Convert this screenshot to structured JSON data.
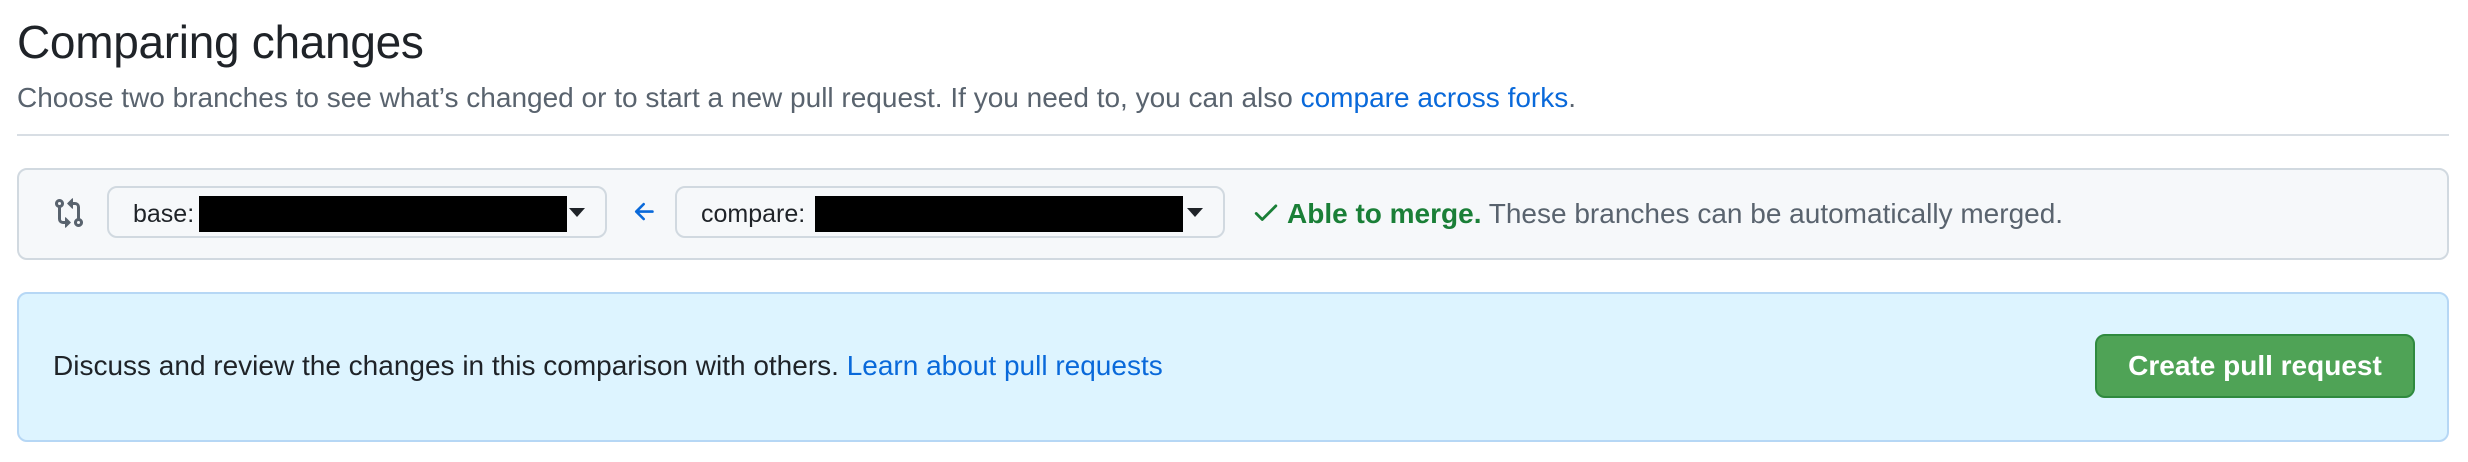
{
  "header": {
    "title": "Comparing changes",
    "subtitle_prefix": "Choose two branches to see what’s changed or to start a new pull request. If you need to, you can also ",
    "subtitle_link": "compare across forks",
    "subtitle_suffix": "."
  },
  "range": {
    "icon": "git-compare-icon",
    "base_label": "base:",
    "compare_label": "compare:",
    "arrow_icon": "arrow-left-icon",
    "merge_icon": "check-icon",
    "merge_title": "Able to merge.",
    "merge_detail": " These branches can be automatically merged."
  },
  "notice": {
    "text": "Discuss and review the changes in this comparison with others. ",
    "link": "Learn about pull requests",
    "button_label": "Create pull request"
  },
  "colors": {
    "link": "#0969da",
    "success": "#1a7f37",
    "notice_bg": "#ddf4ff",
    "button_bg": "#4fa356"
  }
}
